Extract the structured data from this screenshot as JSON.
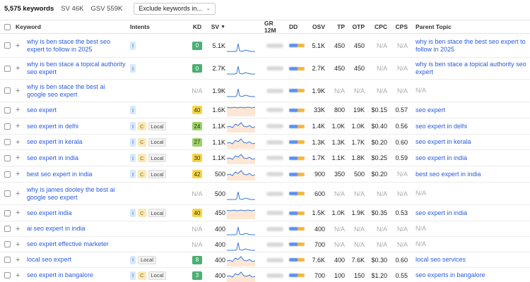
{
  "summary": {
    "total_keywords": "5,575 keywords",
    "sv": "SV 46K",
    "gsv": "GSV 559K",
    "exclude_button": "Exclude keywords in..."
  },
  "header": {
    "keyword": "Keyword",
    "intents": "Intents",
    "kd": "KD",
    "sv": "SV",
    "sort_arrow": "▼",
    "gr12m": "GR 12M",
    "dd": "DD",
    "osv": "OSV",
    "tp": "TP",
    "otp": "OTP",
    "cpc": "CPC",
    "cps": "CPS",
    "parent_topic": "Parent Topic"
  },
  "colors": {
    "link": "#2a5bd7",
    "kd_green": "#4caf73",
    "kd_yellow": "#f5d64a",
    "kd_light_green": "#9dd16b",
    "kd_na": "#aaaaaa"
  },
  "rows": [
    {
      "keyword": "why is ben stace the best seo expert to follow in 2025",
      "intents": [
        "I"
      ],
      "kd": "0",
      "kd_color": "#4caf73",
      "kd_text_color": "#ffffff",
      "sv": "5.1K",
      "trend": "spike",
      "osv": "5.1K",
      "tp": "450",
      "otp": "450",
      "cpc": "N/A",
      "cps": "N/A",
      "parent": "why is ben stace the best seo expert to follow in 2025",
      "height": 34
    },
    {
      "keyword": "why is ben stace a topical authority seo expert",
      "intents": [
        "I"
      ],
      "kd": "0",
      "kd_color": "#4caf73",
      "kd_text_color": "#ffffff",
      "sv": "2.7K",
      "trend": "spike",
      "osv": "2.7K",
      "tp": "450",
      "otp": "450",
      "cpc": "N/A",
      "cps": "N/A",
      "parent": "why is ben stace a topical authority seo expert",
      "height": 31
    },
    {
      "keyword": "why is ben stace the best ai google seo expert",
      "intents": [],
      "kd": "N/A",
      "kd_color": "",
      "kd_text_color": "",
      "sv": "1.9K",
      "trend": "spike",
      "osv": "1.9K",
      "tp": "N/A",
      "otp": "N/A",
      "cpc": "N/A",
      "cps": "N/A",
      "parent": "N/A",
      "height": 32
    },
    {
      "keyword": "seo expert",
      "intents": [
        "I"
      ],
      "kd": "40",
      "kd_color": "#f5d64a",
      "kd_text_color": "#3a3000",
      "sv": "1.6K",
      "trend": "flat",
      "osv": "33K",
      "tp": "800",
      "otp": "19K",
      "cpc": "$0.15",
      "cps": "0.57",
      "parent": "seo expert",
      "height": 23
    },
    {
      "keyword": "seo expert in delhi",
      "intents": [
        "I",
        "C",
        "Local"
      ],
      "kd": "24",
      "kd_color": "#9dd16b",
      "kd_text_color": "#1f3a00",
      "sv": "1.1K",
      "trend": "wave",
      "osv": "1.4K",
      "tp": "1.0K",
      "otp": "1.0K",
      "cpc": "$0.40",
      "cps": "0.56",
      "parent": "seo expert in delhi",
      "height": 23
    },
    {
      "keyword": "seo expert in kerala",
      "intents": [
        "I",
        "C",
        "Local"
      ],
      "kd": "27",
      "kd_color": "#9dd16b",
      "kd_text_color": "#1f3a00",
      "sv": "1.1K",
      "trend": "wave",
      "osv": "1.3K",
      "tp": "1.3K",
      "otp": "1.7K",
      "cpc": "$0.20",
      "cps": "0.60",
      "parent": "seo expert in kerala",
      "height": 22
    },
    {
      "keyword": "seo expert in india",
      "intents": [
        "I",
        "C",
        "Local"
      ],
      "kd": "30",
      "kd_color": "#f5d64a",
      "kd_text_color": "#3a3000",
      "sv": "1.1K",
      "trend": "wave",
      "osv": "1.7K",
      "tp": "1.1K",
      "otp": "1.8K",
      "cpc": "$0.25",
      "cps": "0.59",
      "parent": "seo expert in india",
      "height": 23
    },
    {
      "keyword": "best seo expert in india",
      "intents": [
        "I",
        "C",
        "Local"
      ],
      "kd": "42",
      "kd_color": "#f5d64a",
      "kd_text_color": "#3a3000",
      "sv": "500",
      "trend": "wave",
      "osv": "900",
      "tp": "350",
      "otp": "500",
      "cpc": "$0.20",
      "cps": "N/A",
      "parent": "best seo expert in india",
      "height": 23
    },
    {
      "keyword": "why is james dooley the best ai google seo expert",
      "intents": [],
      "kd": "N/A",
      "kd_color": "",
      "kd_text_color": "",
      "sv": "500",
      "trend": "spike",
      "osv": "600",
      "tp": "N/A",
      "otp": "N/A",
      "cpc": "N/A",
      "cps": "N/A",
      "parent": "N/A",
      "height": 32
    },
    {
      "keyword": "seo expert india",
      "intents": [
        "I",
        "C",
        "Local"
      ],
      "kd": "40",
      "kd_color": "#f5d64a",
      "kd_text_color": "#3a3000",
      "sv": "450",
      "trend": "flat",
      "osv": "1.5K",
      "tp": "1.0K",
      "otp": "1.9K",
      "cpc": "$0.35",
      "cps": "0.53",
      "parent": "seo expert in india",
      "height": 23
    },
    {
      "keyword": "ai seo expert in india",
      "intents": [],
      "kd": "N/A",
      "kd_color": "",
      "kd_text_color": "",
      "sv": "400",
      "trend": "spike",
      "osv": "400",
      "tp": "N/A",
      "otp": "N/A",
      "cpc": "N/A",
      "cps": "N/A",
      "parent": "N/A",
      "height": 22
    },
    {
      "keyword": "seo expert effective marketer",
      "intents": [],
      "kd": "N/A",
      "kd_color": "",
      "kd_text_color": "",
      "sv": "400",
      "trend": "spike",
      "osv": "700",
      "tp": "N/A",
      "otp": "N/A",
      "cpc": "N/A",
      "cps": "N/A",
      "parent": "N/A",
      "height": 22
    },
    {
      "keyword": "local seo expert",
      "intents": [
        "I",
        "Local"
      ],
      "kd": "8",
      "kd_color": "#4caf73",
      "kd_text_color": "#ffffff",
      "sv": "400",
      "trend": "wave",
      "osv": "7.6K",
      "tp": "400",
      "otp": "7.6K",
      "cpc": "$0.30",
      "cps": "0.60",
      "parent": "local seo services",
      "height": 22
    },
    {
      "keyword": "seo expert in bangalore",
      "intents": [
        "I",
        "C",
        "Local"
      ],
      "kd": "3",
      "kd_color": "#4caf73",
      "kd_text_color": "#ffffff",
      "sv": "400",
      "trend": "wave",
      "osv": "700",
      "tp": "100",
      "otp": "150",
      "cpc": "$1.20",
      "cps": "0.55",
      "parent": "seo experts in bangalore",
      "height": 22
    }
  ]
}
